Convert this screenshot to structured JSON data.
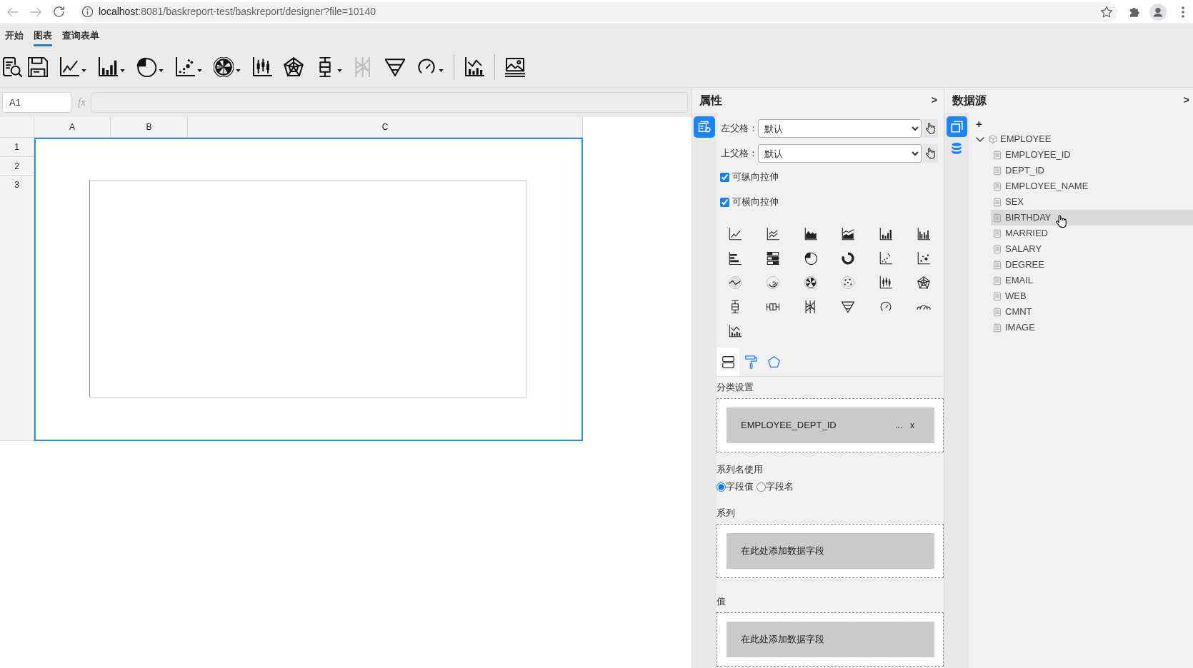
{
  "browser": {
    "url_host": "localhost",
    "url_path": ":8081/baskreport-test/baskreport/designer?file=10140"
  },
  "menu_tabs": [
    {
      "label": "开始",
      "selected": false
    },
    {
      "label": "图表",
      "selected": true
    },
    {
      "label": "查询表单",
      "selected": false
    }
  ],
  "toolbar": [
    {
      "kind": "button",
      "disabled": false
    },
    {
      "kind": "button",
      "disabled": false
    },
    {
      "kind": "button",
      "dropdown": true,
      "disabled": false
    },
    {
      "kind": "button",
      "dropdown": true,
      "disabled": false
    },
    {
      "kind": "button",
      "dropdown": true,
      "disabled": false
    },
    {
      "kind": "button",
      "dropdown": true,
      "disabled": false
    },
    {
      "kind": "button",
      "dropdown": true,
      "disabled": false
    },
    {
      "kind": "button",
      "disabled": false
    },
    {
      "kind": "button",
      "disabled": false
    },
    {
      "kind": "button",
      "dropdown": true,
      "disabled": false
    },
    {
      "kind": "button",
      "disabled": true
    },
    {
      "kind": "button",
      "disabled": false
    },
    {
      "kind": "button",
      "dropdown": true,
      "disabled": false
    },
    {
      "kind": "separator"
    },
    {
      "kind": "button",
      "disabled": false
    },
    {
      "kind": "separator"
    },
    {
      "kind": "button",
      "disabled": false
    }
  ],
  "formula_bar": {
    "cell_ref": "A1",
    "fx": "fx"
  },
  "sheet": {
    "columns": [
      "A",
      "B",
      "C"
    ],
    "rows": [
      "1",
      "2",
      "3"
    ]
  },
  "properties": {
    "title": "属性",
    "toggle": ">",
    "side_tabs": [
      {
        "selected": true
      }
    ],
    "parent_cells": [
      {
        "label": "左父格：",
        "value": "默认"
      },
      {
        "label": "上父格：",
        "value": "默认"
      }
    ],
    "options": [
      {
        "label": "可纵向拉伸",
        "checked": true
      },
      {
        "label": "可横向拉伸",
        "checked": true
      }
    ],
    "tabs": [
      {
        "selected": true
      },
      {
        "selected": false
      },
      {
        "selected": false
      }
    ],
    "category": {
      "label": "分类设置",
      "fields": [
        {
          "name": "EMPLOYEE_DEPT_ID",
          "more": "...",
          "remove": "x"
        }
      ]
    },
    "series_name": {
      "label": "系列名使用",
      "options": [
        {
          "label": "字段值",
          "selected": true
        },
        {
          "label": "字段名",
          "selected": false
        }
      ]
    },
    "series": {
      "label": "系列",
      "prompt": "在此处添加数据字段"
    },
    "value": {
      "label": "值",
      "prompt": "在此处添加数据字段"
    }
  },
  "datasource": {
    "title": "数据源",
    "toggle": ">",
    "side_tabs": [
      {
        "selected": true
      },
      {
        "selected": false
      }
    ],
    "add": "+",
    "tree": [
      {
        "label": "EMPLOYEE",
        "expanded": true,
        "children": [
          {
            "label": "EMPLOYEE_ID",
            "selected": false
          },
          {
            "label": "DEPT_ID",
            "selected": false
          },
          {
            "label": "EMPLOYEE_NAME",
            "selected": false
          },
          {
            "label": "SEX",
            "selected": false
          },
          {
            "label": "BIRTHDAY",
            "selected": true
          },
          {
            "label": "MARRIED",
            "selected": false
          },
          {
            "label": "SALARY",
            "selected": false
          },
          {
            "label": "DEGREE",
            "selected": false
          },
          {
            "label": "EMAIL",
            "selected": false
          },
          {
            "label": "WEB",
            "selected": false
          },
          {
            "label": "CMNT",
            "selected": false
          },
          {
            "label": "IMAGE",
            "selected": false
          }
        ]
      }
    ]
  }
}
